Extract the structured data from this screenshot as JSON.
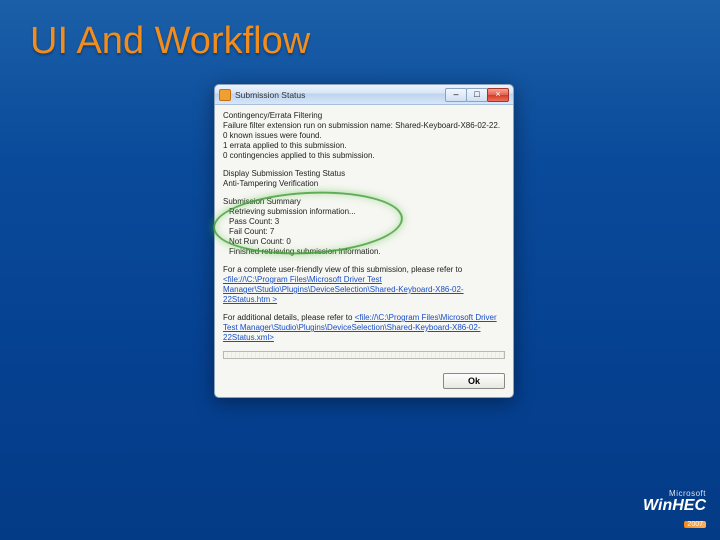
{
  "slide": {
    "title": "UI And Workflow"
  },
  "window": {
    "title": "Submission Status",
    "buttons": {
      "minimize": "–",
      "maximize": "□",
      "close": "×"
    }
  },
  "status_block": {
    "heading": "Contingency/Errata Filtering",
    "lines": [
      "Failure filter extension run on submission name: Shared-Keyboard-X86-02-22.",
      "0 known issues were found.",
      "1 errata applied to this submission.",
      "0 contingencies applied to this submission."
    ]
  },
  "testing_block": {
    "line1": "Display Submission Testing Status",
    "line2": "Anti-Tampering Verification"
  },
  "summary_block": {
    "heading": "Submission Summary",
    "lines": [
      "Retrieving submission information...",
      "Pass Count: 3",
      "Fail Count: 7",
      "Not Run Count: 0",
      "Finished retrieving submission information."
    ]
  },
  "friendly_block": {
    "intro": "For a complete user-friendly view of this submission, please refer to ",
    "link": "<file://\\C:\\Program Files\\Microsoft Driver Test Manager\\Studio\\Plugins\\DeviceSelection\\Shared-Keyboard-X86-02-22Status.htm >"
  },
  "details_block": {
    "intro": "For additional details, please refer to ",
    "link": "<file://\\C:\\Program Files\\Microsoft Driver Test Manager\\Studio\\Plugins\\DeviceSelection\\Shared-Keyboard-X86-02-22Status.xml>"
  },
  "ok_button": "Ok",
  "footer": {
    "ms": "Microsoft",
    "brand": "WinHEC",
    "year": "2007"
  }
}
